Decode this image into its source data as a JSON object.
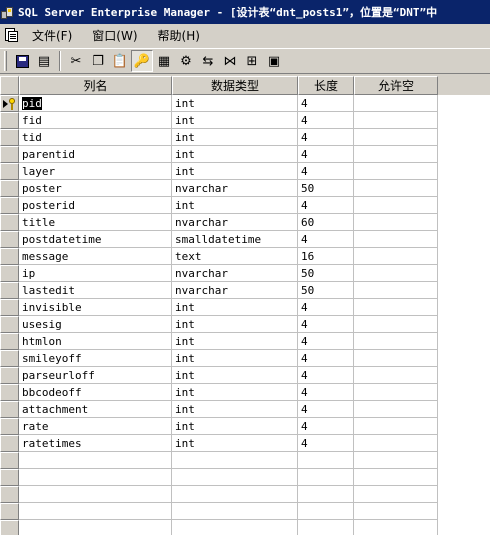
{
  "window": {
    "title": "SQL Server Enterprise Manager - [设计表“dnt_posts1”，位置是“DNT”中"
  },
  "menu": {
    "items": [
      {
        "name": "menu-file",
        "label": "文件(F)"
      },
      {
        "name": "menu-window",
        "label": "窗口(W)"
      },
      {
        "name": "menu-help",
        "label": "帮助(H)"
      }
    ]
  },
  "toolbar": {
    "buttons": [
      {
        "name": "save-icon",
        "glyph": ""
      },
      {
        "name": "properties-icon",
        "glyph": "▤"
      },
      {
        "name": "cut-icon",
        "glyph": "✂"
      },
      {
        "name": "copy-icon",
        "glyph": "❐"
      },
      {
        "name": "paste-icon",
        "glyph": "📋"
      },
      {
        "name": "primary-key-icon",
        "glyph": "🔑"
      },
      {
        "name": "manage-indexes-icon",
        "glyph": "▦"
      },
      {
        "name": "manage-triggers-icon",
        "glyph": "⚙"
      },
      {
        "name": "insert-column-icon",
        "glyph": "⇆"
      },
      {
        "name": "manage-relationships-icon",
        "glyph": "⋈"
      },
      {
        "name": "manage-constraints-icon",
        "glyph": "⊞"
      },
      {
        "name": "generate-script-icon",
        "glyph": "▣"
      }
    ]
  },
  "grid": {
    "headers": {
      "name": "列名",
      "type": "数据类型",
      "length": "长度",
      "nullable": "允许空"
    },
    "rows": [
      {
        "name": "pid",
        "type": "int",
        "length": "4"
      },
      {
        "name": "fid",
        "type": "int",
        "length": "4"
      },
      {
        "name": "tid",
        "type": "int",
        "length": "4"
      },
      {
        "name": "parentid",
        "type": "int",
        "length": "4"
      },
      {
        "name": "layer",
        "type": "int",
        "length": "4"
      },
      {
        "name": "poster",
        "type": "nvarchar",
        "length": "50"
      },
      {
        "name": "posterid",
        "type": "int",
        "length": "4"
      },
      {
        "name": "title",
        "type": "nvarchar",
        "length": "60"
      },
      {
        "name": "postdatetime",
        "type": "smalldatetime",
        "length": "4"
      },
      {
        "name": "message",
        "type": "text",
        "length": "16"
      },
      {
        "name": "ip",
        "type": "nvarchar",
        "length": "50"
      },
      {
        "name": "lastedit",
        "type": "nvarchar",
        "length": "50"
      },
      {
        "name": "invisible",
        "type": "int",
        "length": "4"
      },
      {
        "name": "usesig",
        "type": "int",
        "length": "4"
      },
      {
        "name": "htmlon",
        "type": "int",
        "length": "4"
      },
      {
        "name": "smileyoff",
        "type": "int",
        "length": "4"
      },
      {
        "name": "parseurloff",
        "type": "int",
        "length": "4"
      },
      {
        "name": "bbcodeoff",
        "type": "int",
        "length": "4"
      },
      {
        "name": "attachment",
        "type": "int",
        "length": "4"
      },
      {
        "name": "rate",
        "type": "int",
        "length": "4"
      },
      {
        "name": "ratetimes",
        "type": "int",
        "length": "4"
      }
    ]
  }
}
